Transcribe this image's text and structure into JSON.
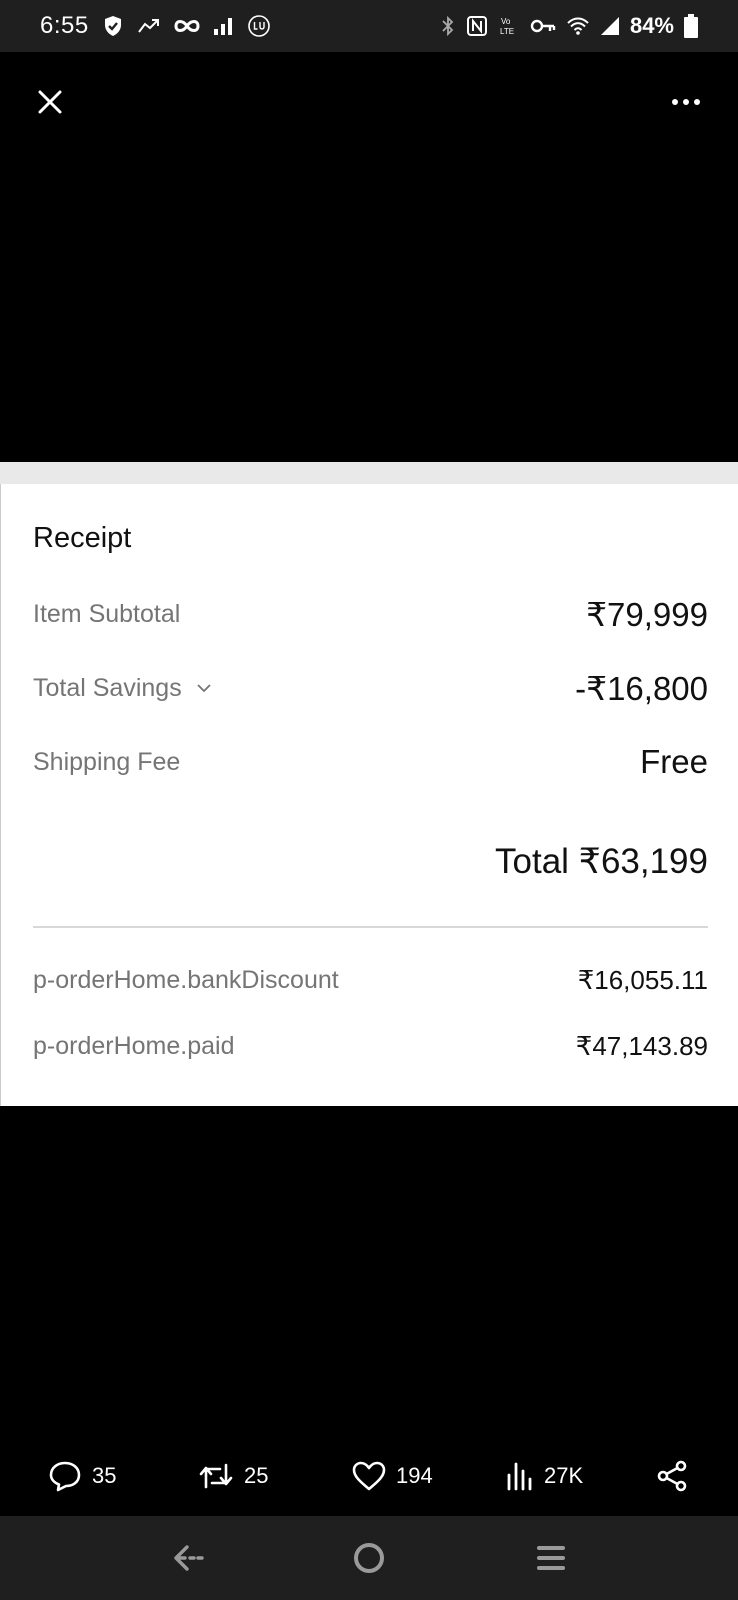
{
  "status_bar": {
    "time": "6:55",
    "battery": "84%"
  },
  "receipt": {
    "title": "Receipt",
    "rows": [
      {
        "label": "Item Subtotal",
        "value": "₹79,999"
      },
      {
        "label": "Total Savings",
        "value": "-₹16,800"
      },
      {
        "label": "Shipping Fee",
        "value": "Free"
      }
    ],
    "total": "Total ₹63,199",
    "extra_rows": [
      {
        "label": "p-orderHome.bankDiscount",
        "value": "₹16,055.11"
      },
      {
        "label": "p-orderHome.paid",
        "value": "₹47,143.89"
      }
    ]
  },
  "actions": {
    "replies": "35",
    "reposts": "25",
    "likes": "194",
    "views": "27K"
  },
  "colors": {
    "background": "#000000",
    "system_bar": "#1f1f1f",
    "receipt_bg": "#ffffff",
    "label_gray": "#757575"
  }
}
